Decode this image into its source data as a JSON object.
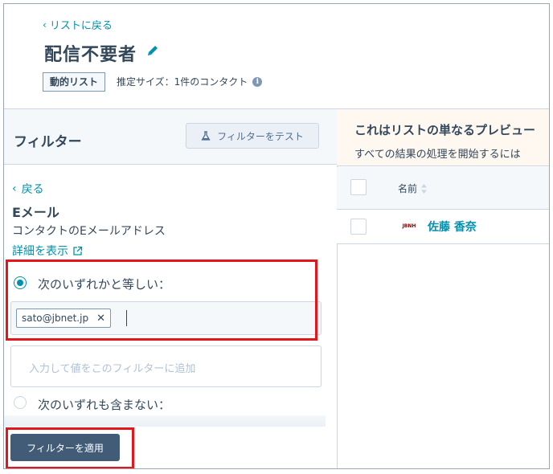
{
  "header": {
    "back_label": "リストに戻る",
    "title": "配信不要者",
    "list_type": "動的リスト",
    "estimated_size": "推定サイズ：1件のコンタクト"
  },
  "filter_panel": {
    "title": "フィルター",
    "test_button": "フィルターをテスト",
    "back_label": "戻る",
    "property_name": "Eメール",
    "property_description": "コンタクトのEメールアドレス",
    "details_link": "詳細を表示",
    "option_equals": "次のいずれかと等しい：",
    "option_not_contains": "次のいずれも含まない：",
    "selected_option": "equals",
    "tags": [
      "sato@jbnet.jp"
    ],
    "value_placeholder": "入力して値をこのフィルターに追加",
    "apply_button": "フィルターを適用"
  },
  "preview": {
    "banner_title": "これはリストの単なるプレビュー",
    "banner_text": "すべての結果の処理を開始するには",
    "columns": [
      "名前"
    ],
    "rows": [
      {
        "avatar_text": "JBNH",
        "name": "佐藤 香奈"
      }
    ]
  },
  "colors": {
    "link": "#0091ae",
    "primary_button": "#425b76",
    "highlight": "#e3161b"
  },
  "icons": [
    "chevron-left-icon",
    "pencil-icon",
    "info-icon",
    "flask-icon",
    "external-link-icon",
    "close-icon",
    "sort-icon"
  ]
}
